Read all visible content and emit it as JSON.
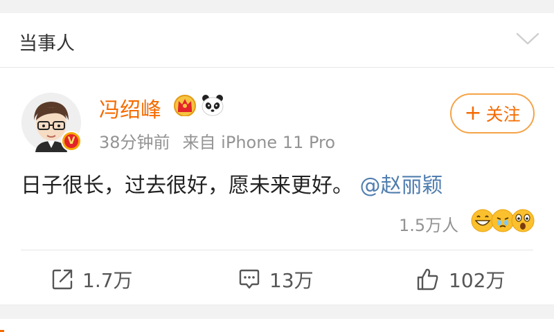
{
  "header": {
    "title": "当事人",
    "collapse_icon": "chevron-down-icon"
  },
  "post": {
    "username": "冯绍峰",
    "badges": [
      "crown-icon",
      "panda-icon"
    ],
    "verified_badge": "V",
    "time": "38分钟前",
    "source": "来自 iPhone 11 Pro",
    "follow_label": "关注",
    "follow_plus": "+",
    "text": "日子很长，过去很好，愿未来更好。",
    "mention": "@赵丽颖",
    "reaction_count": "1.5万人",
    "reaction_icons": [
      "grin-emoji-icon",
      "teary-emoji-icon",
      "surprised-emoji-icon"
    ]
  },
  "actions": {
    "repost": {
      "icon": "share-icon",
      "count": "1.7万"
    },
    "comment": {
      "icon": "comment-icon",
      "count": "13万"
    },
    "like": {
      "icon": "thumbs-up-icon",
      "count": "102万"
    }
  },
  "colors": {
    "accent": "#f56b00",
    "link": "#507daf",
    "meta": "#939393",
    "background": "#f2f2f2"
  }
}
